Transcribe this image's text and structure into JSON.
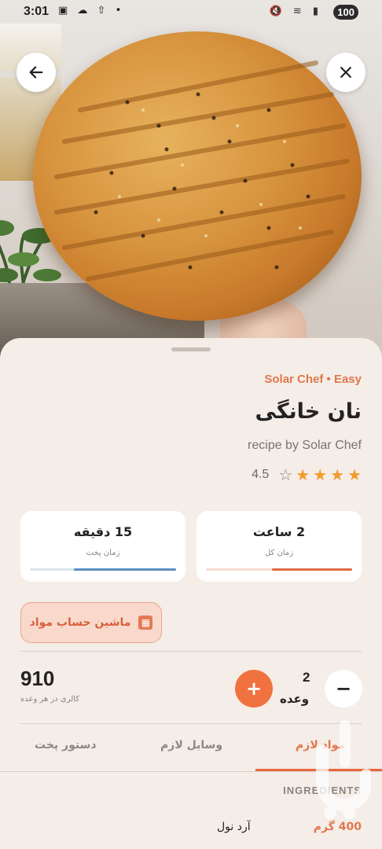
{
  "status_bar": {
    "time": "3:01",
    "left_icons": "▣ ☁ ⇧ •",
    "right_icons": "🔇 ≋ ▮",
    "battery": "100"
  },
  "nav": {
    "back_icon": "arrow-left-icon",
    "close_icon": "close-icon"
  },
  "recipe": {
    "meta": "Solar Chef • Easy",
    "title": "نان خانگی",
    "byline": "recipe by Solar Chef",
    "rating": "4.5",
    "stars_filled": 4,
    "stars_total": 5
  },
  "stats": {
    "total_time_value": "2 ساعت",
    "total_time_label": "زمان کل",
    "cook_time_value": "15 دقیقه",
    "cook_time_label": "زمان پخت",
    "total_fill": 0.55,
    "cook_fill": 0.7
  },
  "calculator": {
    "label": "ماشین حساب مواد"
  },
  "nutrition": {
    "calories": "910",
    "calories_label": "کالری در هر وعده",
    "servings": "2",
    "servings_label": "وعده",
    "plus": "+",
    "minus": "−"
  },
  "tabs": {
    "ingredients": "مواد لازم",
    "tools": "وسایل لازم",
    "steps": "دستور پخت"
  },
  "ingredients": {
    "header": "INGREDIENTS",
    "items": [
      {
        "qty": "400 گرم",
        "name": "آرد نول"
      }
    ]
  },
  "colors": {
    "accent": "#e0774f",
    "accent_strong": "#f07240",
    "blue_bar": "#5b8fbd",
    "orange_bar": "#e06b45"
  }
}
